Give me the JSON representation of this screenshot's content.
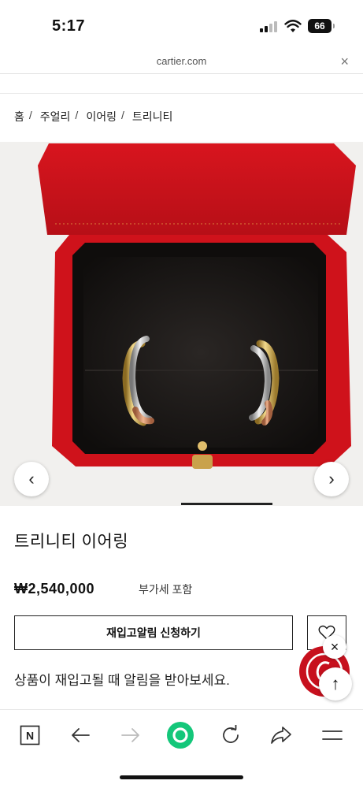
{
  "status_bar": {
    "time": "5:17",
    "battery": "66"
  },
  "browser": {
    "url": "cartier.com",
    "close_glyph": "×"
  },
  "breadcrumb": [
    {
      "label": "홈"
    },
    {
      "label": "주얼리"
    },
    {
      "label": "이어링"
    },
    {
      "label": "트리니티"
    }
  ],
  "breadcrumb_separator": "/",
  "gallery": {
    "prev_glyph": "‹",
    "next_glyph": "›"
  },
  "product": {
    "name": "트리니티 이어링",
    "price": "₩2,540,000",
    "vat_note": "부가세 포함",
    "notify_label": "재입고알림 신청하기",
    "notify_description": "상품이 재입고될 때 알림을 받아보세요."
  },
  "floating": {
    "close_glyph": "×",
    "top_glyph": "↑"
  },
  "toolbar": {
    "icons": [
      "naver-icon",
      "back-arrow-icon",
      "forward-arrow-icon",
      "home-dot-icon",
      "refresh-icon",
      "share-icon",
      "menu-icon"
    ],
    "naver_letter": "N"
  },
  "colors": {
    "brand_red": "#c7101d",
    "box_red": "#d3141c",
    "toolbar_green": "#14c77a"
  }
}
